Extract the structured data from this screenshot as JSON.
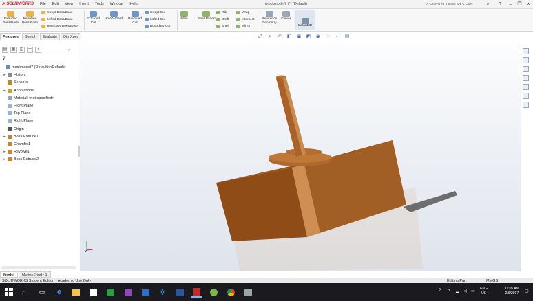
{
  "app": {
    "brand": "SOLIDWORKS",
    "brand_color": "#d4202c",
    "window_title": "mockmodel7 (*) (Default)",
    "menu": [
      "File",
      "Edit",
      "View",
      "Insert",
      "Tools",
      "Window",
      "Help"
    ],
    "search_label": "Search SOLIDWORKS Files"
  },
  "ribbon": {
    "extruded_boss": "Extruded\nBoss/Base",
    "revolved_boss": "Revolved\nBoss/Base",
    "swept_boss": "Swept Boss/Base",
    "lofted_boss": "Lofted Boss/Base",
    "boundary_boss": "Boundary Boss/Base",
    "extruded_cut": "Extruded\nCut",
    "hole_wizard": "Hole Wizard",
    "revolved_cut": "Revolved\nCut",
    "swept_cut": "Swept Cut",
    "lofted_cut": "Lofted Cut",
    "boundary_cut": "Boundary Cut",
    "fillet": "Fillet",
    "linear_pattern": "Linear Pattern",
    "rib": "Rib",
    "draft": "Draft",
    "shell": "Shell",
    "wrap": "Wrap",
    "intersect": "Intersect",
    "mirror": "Mirror",
    "reference_geometry": "Reference\nGeometry",
    "curves": "Curves",
    "instant3d": "Instant3D"
  },
  "tabs": [
    "Features",
    "Sketch",
    "Evaluate",
    "DimXpert"
  ],
  "tree": [
    {
      "label": "mockmodel7 (Default<<Default>",
      "icon": "part-icon",
      "expand": "",
      "icon_color": "#6c8ebf"
    },
    {
      "label": "History",
      "icon": "history-icon",
      "expand": "▸",
      "icon_color": "#8a8a8a"
    },
    {
      "label": "Sensors",
      "icon": "sensor-icon",
      "expand": "",
      "icon_color": "#b38b2e"
    },
    {
      "label": "Annotations",
      "icon": "annotation-icon",
      "expand": "▸",
      "icon_color": "#c2a23a"
    },
    {
      "label": "Material <not specified>",
      "icon": "material-icon",
      "expand": "",
      "icon_color": "#9aa3ad"
    },
    {
      "label": "Front Plane",
      "icon": "plane-icon",
      "expand": "",
      "icon_color": "#9bb3cc"
    },
    {
      "label": "Top Plane",
      "icon": "plane-icon",
      "expand": "",
      "icon_color": "#9bb3cc"
    },
    {
      "label": "Right Plane",
      "icon": "plane-icon",
      "expand": "",
      "icon_color": "#9bb3cc"
    },
    {
      "label": "Origin",
      "icon": "origin-icon",
      "expand": "",
      "icon_color": "#555555"
    },
    {
      "label": "Boss-Extrude1",
      "icon": "extrude-icon",
      "expand": "▸",
      "icon_color": "#c4853a"
    },
    {
      "label": "Chamfer1",
      "icon": "chamfer-icon",
      "expand": "",
      "icon_color": "#c4853a"
    },
    {
      "label": "Revolve1",
      "icon": "revolve-icon",
      "expand": "▸",
      "icon_color": "#c4853a"
    },
    {
      "label": "Boss-Extrude2",
      "icon": "extrude-icon",
      "expand": "▸",
      "icon_color": "#c4853a"
    }
  ],
  "bottom_tabs": [
    "Model",
    "Motion Study 1"
  ],
  "status": {
    "left": "SOLIDWORKS Student Edition - Academic Use Only",
    "mid": "Editing Part",
    "units": "MMGS"
  },
  "taskbar": {
    "clock_time": "11:05 AM",
    "clock_date": "2/6/2017",
    "lang": "ENG",
    "region": "US"
  },
  "colors": {
    "part_main": "#a05a22",
    "part_light": "#c8854a",
    "part_dark": "#7a3f12"
  }
}
